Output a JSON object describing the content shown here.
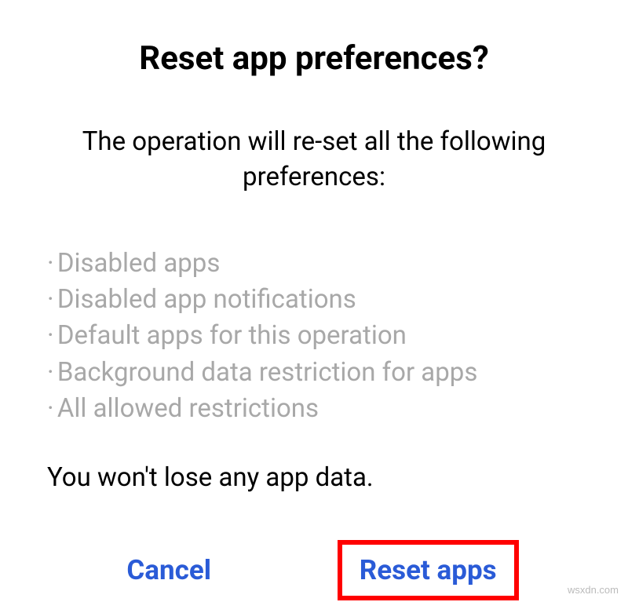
{
  "dialog": {
    "title": "Reset app preferences?",
    "description": "The operation will re-set all the following preferences:",
    "list": {
      "item0": "Disabled apps",
      "item1": "Disabled app notifications",
      "item2": "Default apps for this operation",
      "item3": "Background data restriction for apps",
      "item4": "All allowed restrictions"
    },
    "footer_note": "You won't lose any app data.",
    "buttons": {
      "cancel": "Cancel",
      "confirm": "Reset apps"
    }
  },
  "watermark": "wsxdn.com"
}
